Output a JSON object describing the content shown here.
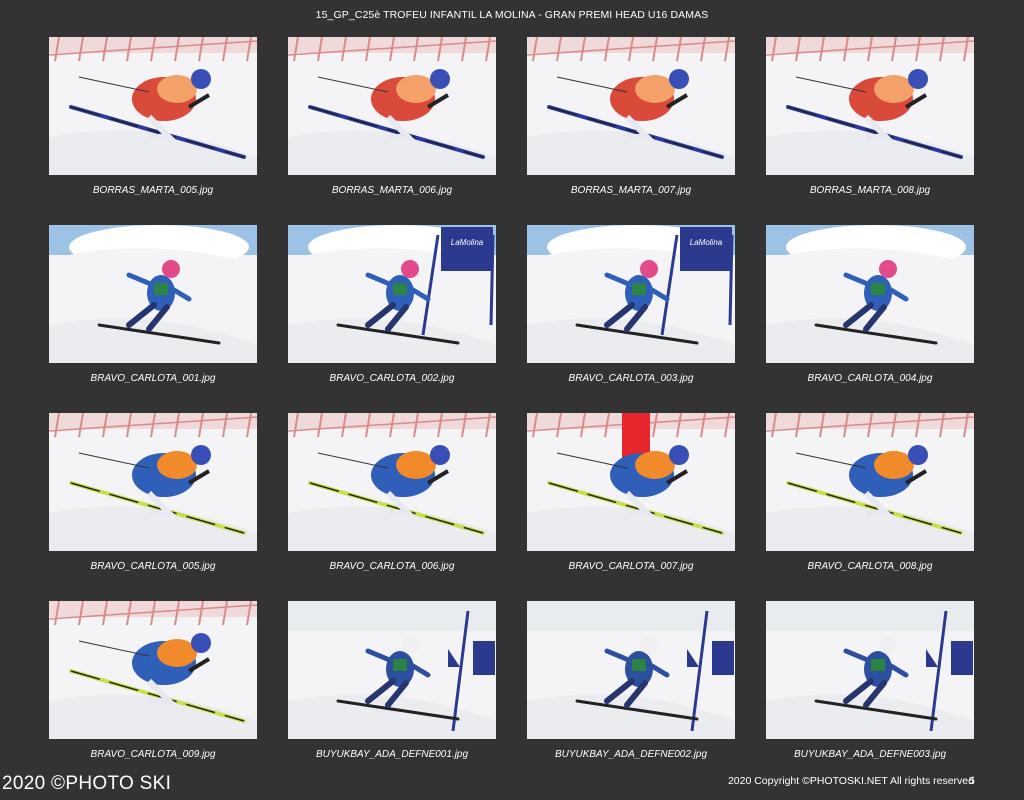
{
  "header": {
    "title": "15_GP_C25è TROFEU INFANTIL LA MOLINA - GRAN PREMI HEAD U16 DAMAS"
  },
  "photos": [
    {
      "filename": "BORRAS_MARTA_005.jpg",
      "scene": "tuck-red"
    },
    {
      "filename": "BORRAS_MARTA_006.jpg",
      "scene": "tuck-red"
    },
    {
      "filename": "BORRAS_MARTA_007.jpg",
      "scene": "tuck-red"
    },
    {
      "filename": "BORRAS_MARTA_008.jpg",
      "scene": "tuck-red"
    },
    {
      "filename": "BRAVO_CARLOTA_001.jpg",
      "scene": "gs-sky"
    },
    {
      "filename": "BRAVO_CARLOTA_002.jpg",
      "scene": "gs-gate"
    },
    {
      "filename": "BRAVO_CARLOTA_003.jpg",
      "scene": "gs-gate"
    },
    {
      "filename": "BRAVO_CARLOTA_004.jpg",
      "scene": "gs-sky"
    },
    {
      "filename": "BRAVO_CARLOTA_005.jpg",
      "scene": "tuck-orange"
    },
    {
      "filename": "BRAVO_CARLOTA_006.jpg",
      "scene": "tuck-orange"
    },
    {
      "filename": "BRAVO_CARLOTA_007.jpg",
      "scene": "tuck-orange-flag"
    },
    {
      "filename": "BRAVO_CARLOTA_008.jpg",
      "scene": "tuck-orange"
    },
    {
      "filename": "BRAVO_CARLOTA_009.jpg",
      "scene": "tuck-orange"
    },
    {
      "filename": "BUYUKBAY_ADA_DEFNE001.jpg",
      "scene": "gs-blue"
    },
    {
      "filename": "BUYUKBAY_ADA_DEFNE002.jpg",
      "scene": "gs-blue"
    },
    {
      "filename": "BUYUKBAY_ADA_DEFNE003.jpg",
      "scene": "gs-blue"
    }
  ],
  "gate_banner_text": "LaMolina",
  "footer": {
    "watermark": "2020 ©PHOTO SKI",
    "copyright": "2020 Copyright ©PHOTOSKI.NET All rights reserved",
    "page_number": "5"
  },
  "colors": {
    "background": "#333333",
    "snow": "#f4f4f6",
    "safety_net": "#d98a8a",
    "sky": "#9cc3e6",
    "gate_panel": "#2b3a8f",
    "suit_red": "#d94a3a",
    "suit_blue": "#2f5fb8",
    "bib_orange": "#f08a2a"
  }
}
